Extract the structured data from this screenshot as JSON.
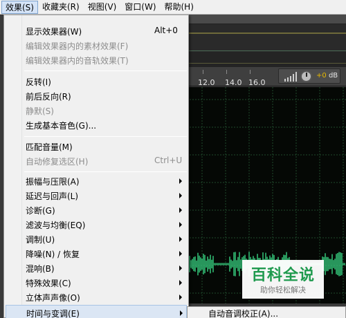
{
  "menubar": {
    "items": [
      {
        "label": "效果(S)",
        "active": true
      },
      {
        "label": "收藏夹(R)",
        "active": false
      },
      {
        "label": "视图(V)",
        "active": false
      },
      {
        "label": "窗口(W)",
        "active": false
      },
      {
        "label": "帮助(H)",
        "active": false
      }
    ]
  },
  "effects_menu": {
    "items": [
      {
        "label": "显示效果器(W)",
        "shortcut": "Alt+0",
        "disabled": false
      },
      {
        "label": "编辑效果器内的素材效果(F)",
        "disabled": true
      },
      {
        "label": "编辑效果器内的音轨效果(T)",
        "disabled": true
      },
      {
        "label": "反转(I)",
        "disabled": false
      },
      {
        "label": "前后反向(R)",
        "disabled": false
      },
      {
        "label": "静默(S)",
        "disabled": true
      },
      {
        "label": "生成基本音色(G)...",
        "disabled": false
      },
      {
        "label": "匹配音量(M)",
        "disabled": false
      },
      {
        "label": "自动修复选区(H)",
        "shortcut": "Ctrl+U",
        "disabled": true
      },
      {
        "label": "振幅与压限(A)",
        "submenu": true
      },
      {
        "label": "延迟与回声(L)",
        "submenu": true
      },
      {
        "label": "诊断(G)",
        "submenu": true
      },
      {
        "label": "滤波与均衡(EQ)",
        "submenu": true
      },
      {
        "label": "调制(U)",
        "submenu": true
      },
      {
        "label": "降噪(N) / 恢复",
        "submenu": true
      },
      {
        "label": "混响(B)",
        "submenu": true
      },
      {
        "label": "特殊效果(C)",
        "submenu": true
      },
      {
        "label": "立体声声像(O)",
        "submenu": true
      },
      {
        "label": "时间与变调(E)",
        "submenu": true,
        "highlighted": true
      }
    ]
  },
  "submenu": {
    "items": [
      {
        "label": "自动音调校正(A)..."
      }
    ]
  },
  "timeline": {
    "ticks": [
      "12.0",
      "14.0",
      "16.0"
    ],
    "volume": {
      "sign": "+",
      "value": "0",
      "unit": "dB"
    }
  },
  "watermark": {
    "title": "百科全说",
    "subtitle": "助你轻松解决"
  },
  "colors": {
    "waveform": "#35c57a",
    "grid": "#1f4a2c",
    "menu_highlight": "#dbe6f4",
    "watermark_green": "#1f9a4e"
  }
}
